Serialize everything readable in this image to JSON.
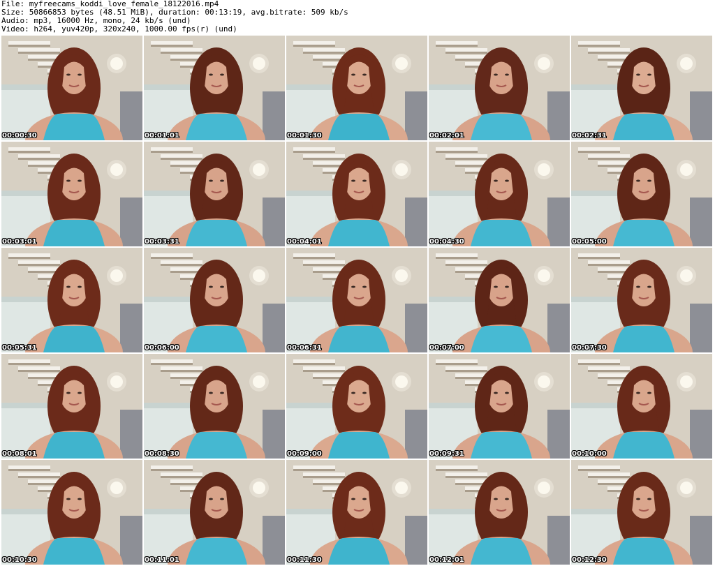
{
  "header": {
    "file_line": "File: myfreecams_koddi_love_female_18122016.mp4",
    "size_line": "Size: 50866853 bytes (48.51 MiB), duration: 00:13:19, avg.bitrate: 509 kb/s",
    "audio_line": "Audio: mp3, 16000 Hz, mono, 24 kb/s (und)",
    "video_line": "Video: h264, yuv420p, 320x240, 1000.00 fps(r) (und)"
  },
  "thumbnails": [
    {
      "timestamp": "00:00:30",
      "hair": "#6b2a1a",
      "top": "#3fb6cf",
      "skin": "#d9a48a"
    },
    {
      "timestamp": "00:01:01",
      "hair": "#5e2617",
      "top": "#46b9d2",
      "skin": "#d9a58c"
    },
    {
      "timestamp": "00:01:30",
      "hair": "#6e2b19",
      "top": "#3db3cc",
      "skin": "#dba98f"
    },
    {
      "timestamp": "00:02:01",
      "hair": "#62281a",
      "top": "#48bad3",
      "skin": "#d8a38a"
    },
    {
      "timestamp": "00:02:31",
      "hair": "#5a2416",
      "top": "#42b5cf",
      "skin": "#dcab92"
    },
    {
      "timestamp": "00:03:01",
      "hair": "#6a2a1a",
      "top": "#3fb4cd",
      "skin": "#d9a58b"
    },
    {
      "timestamp": "00:03:31",
      "hair": "#612718",
      "top": "#45b8d1",
      "skin": "#d7a38a"
    },
    {
      "timestamp": "00:04:01",
      "hair": "#6c2b1a",
      "top": "#41b6cf",
      "skin": "#daa78d"
    },
    {
      "timestamp": "00:04:30",
      "hair": "#672919",
      "top": "#43b7d0",
      "skin": "#d9a68c"
    },
    {
      "timestamp": "00:05:00",
      "hair": "#5f2617",
      "top": "#46b9d2",
      "skin": "#d8a48b"
    },
    {
      "timestamp": "00:05:31",
      "hair": "#6d2b1a",
      "top": "#3fb3cc",
      "skin": "#dba88e"
    },
    {
      "timestamp": "00:06:00",
      "hair": "#642818",
      "top": "#44b8d1",
      "skin": "#d9a58c"
    },
    {
      "timestamp": "00:06:31",
      "hair": "#6a2a19",
      "top": "#42b5ce",
      "skin": "#daa68d"
    },
    {
      "timestamp": "00:07:00",
      "hair": "#5d2517",
      "top": "#47bad3",
      "skin": "#d8a38a"
    },
    {
      "timestamp": "00:07:30",
      "hair": "#692a1a",
      "top": "#41b6cf",
      "skin": "#d9a68c"
    },
    {
      "timestamp": "00:08:01",
      "hair": "#6b2a1a",
      "top": "#40b4cd",
      "skin": "#daa78d"
    },
    {
      "timestamp": "00:08:30",
      "hair": "#632818",
      "top": "#45b8d1",
      "skin": "#d8a48b"
    },
    {
      "timestamp": "00:09:00",
      "hair": "#6e2c1a",
      "top": "#3fb5ce",
      "skin": "#dba98f"
    },
    {
      "timestamp": "00:09:31",
      "hair": "#5f2617",
      "top": "#46b9d2",
      "skin": "#d9a58c"
    },
    {
      "timestamp": "00:10:00",
      "hair": "#682919",
      "top": "#42b6cf",
      "skin": "#d9a68c"
    },
    {
      "timestamp": "00:10:30",
      "hair": "#6b2a1a",
      "top": "#40b5ce",
      "skin": "#daa78d"
    },
    {
      "timestamp": "00:11:01",
      "hair": "#612718",
      "top": "#45b8d1",
      "skin": "#d8a38a"
    },
    {
      "timestamp": "00:11:30",
      "hair": "#6d2b1a",
      "top": "#3fb4cd",
      "skin": "#dba88e"
    },
    {
      "timestamp": "00:12:01",
      "hair": "#642818",
      "top": "#44b7d0",
      "skin": "#d9a58c"
    },
    {
      "timestamp": "00:12:30",
      "hair": "#692a19",
      "top": "#42b6cf",
      "skin": "#daa68d"
    }
  ]
}
